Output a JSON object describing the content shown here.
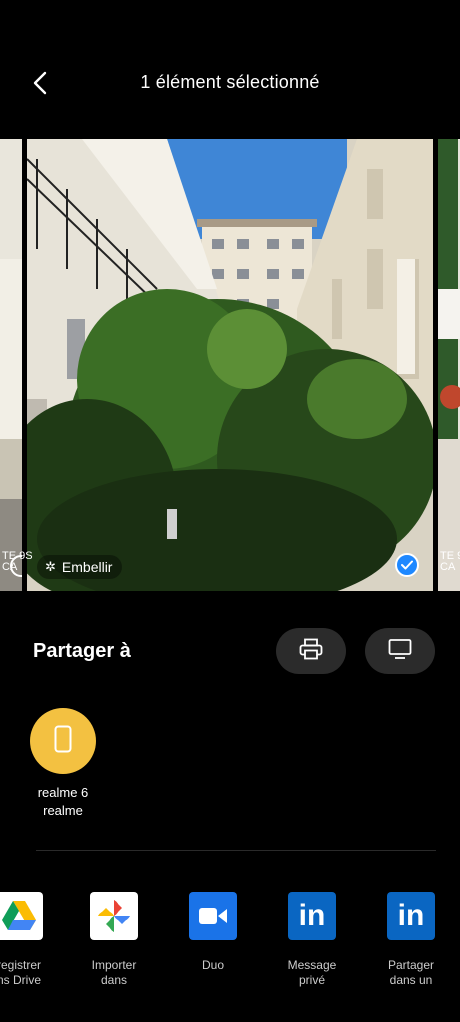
{
  "header": {
    "title": "1 élément sélectionné",
    "back_icon": "back-arrow-icon"
  },
  "carousel": {
    "left_peek_text": [
      "TE 9S",
      "CA"
    ],
    "right_peek_text": [
      "TE 9",
      "CA"
    ],
    "embellir_label": "Embellir",
    "selected": true
  },
  "share": {
    "title": "Partager à",
    "actions": [
      {
        "name": "print",
        "icon": "printer-icon"
      },
      {
        "name": "screen",
        "icon": "monitor-icon"
      }
    ],
    "devices": [
      {
        "line1": "realme 6",
        "line2": "realme",
        "icon": "phone-icon",
        "color": "#f3c141"
      }
    ]
  },
  "apps": [
    {
      "line1": "registrer",
      "line2": "ns Drive",
      "icon": "google-drive-icon"
    },
    {
      "line1": "Importer",
      "line2": "dans",
      "icon": "google-photos-icon"
    },
    {
      "line1": "Duo",
      "line2": "",
      "icon": "duo-icon",
      "color": "#1a73e8"
    },
    {
      "line1": "Message",
      "line2": "privé",
      "icon": "linkedin-icon",
      "color": "#0a66c2"
    },
    {
      "line1": "Partager",
      "line2": "dans un",
      "icon": "linkedin-icon",
      "color": "#0a66c2"
    }
  ]
}
